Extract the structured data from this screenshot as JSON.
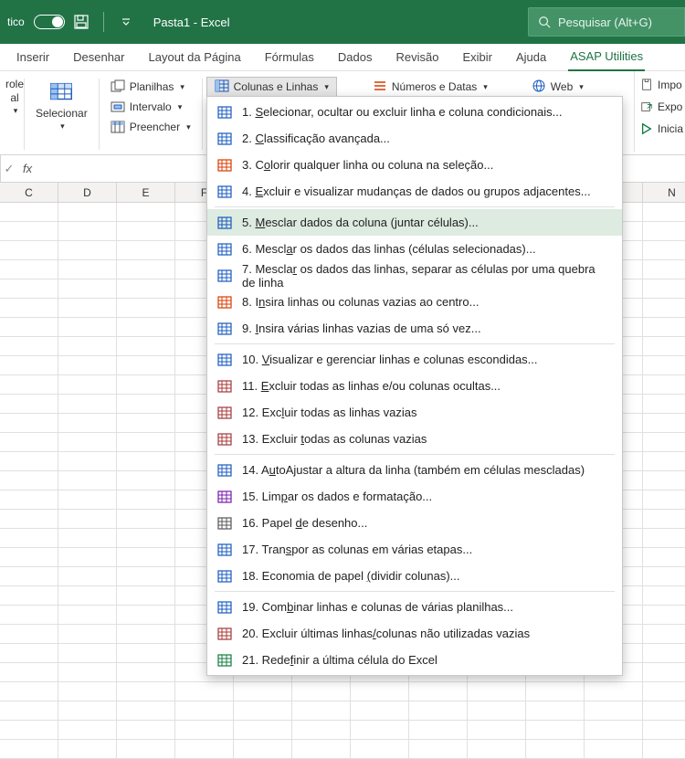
{
  "titlebar": {
    "auto_label": "tico",
    "title": "Pasta1  -  Excel",
    "search_placeholder": "Pesquisar (Alt+G)"
  },
  "tabs": {
    "inserir": "Inserir",
    "desenhar": "Desenhar",
    "layout": "Layout da Página",
    "formulas": "Fórmulas",
    "dados": "Dados",
    "revisao": "Revisão",
    "exibir": "Exibir",
    "ajuda": "Ajuda",
    "asap": "ASAP Utilities"
  },
  "ribbon": {
    "role_top": "role",
    "role_bottom": "al",
    "selecionar": "Selecionar",
    "planilhas": "Planilhas",
    "intervalo": "Intervalo",
    "preencher": "Preencher",
    "colunaslinhas": "Colunas e Linhas",
    "numerosdatas": "Números e Datas",
    "web": "Web",
    "impo": "Impo",
    "expo": "Expo",
    "inicia": "Inicia"
  },
  "formula": {
    "fx": "fx"
  },
  "columns": [
    "C",
    "D",
    "E",
    "F",
    "",
    "",
    "",
    "",
    "",
    "",
    "",
    "N"
  ],
  "menu": {
    "items": [
      {
        "n": "1.",
        "pre": "",
        "u": "S",
        "post": "elecionar, ocultar ou excluir linha e coluna condicionais..."
      },
      {
        "n": "2.",
        "pre": "",
        "u": "C",
        "post": "lassificação avançada..."
      },
      {
        "n": "3.",
        "pre": "C",
        "u": "o",
        "post": "lorir qualquer linha ou coluna na seleção..."
      },
      {
        "n": "4.",
        "pre": "",
        "u": "E",
        "post": "xcluir e visualizar mudanças de dados ou grupos adjacentes..."
      },
      {
        "n": "5.",
        "pre": "",
        "u": "M",
        "post": "esclar dados da coluna (juntar células)...",
        "hover": true
      },
      {
        "n": "6.",
        "pre": "Mescl",
        "u": "a",
        "post": "r os dados das linhas (células selecionadas)..."
      },
      {
        "n": "7.",
        "pre": "Mescla",
        "u": "r",
        "post": " os dados das linhas, separar as células por uma quebra de linha"
      },
      {
        "n": "8.",
        "pre": "I",
        "u": "n",
        "post": "sira linhas ou colunas vazias ao centro..."
      },
      {
        "n": "9.",
        "pre": "",
        "u": "I",
        "post": "nsira várias linhas vazias de uma só vez..."
      },
      {
        "n": "10.",
        "pre": "",
        "u": "V",
        "post": "isualizar e gerenciar linhas e colunas escondidas..."
      },
      {
        "n": "11.",
        "pre": "",
        "u": "E",
        "post": "xcluir todas as linhas e/ou colunas ocultas..."
      },
      {
        "n": "12.",
        "pre": "Exc",
        "u": "l",
        "post": "uir todas as linhas vazias"
      },
      {
        "n": "13.",
        "pre": "Excluir ",
        "u": "t",
        "post": "odas as colunas vazias"
      },
      {
        "n": "14.",
        "pre": "A",
        "u": "u",
        "post": "toAjustar a altura da linha (também em células mescladas)"
      },
      {
        "n": "15.",
        "pre": "Lim",
        "u": "p",
        "post": "ar os dados e formatação..."
      },
      {
        "n": "16.",
        "pre": "Papel ",
        "u": "d",
        "post": "e desenho..."
      },
      {
        "n": "17.",
        "pre": "Tran",
        "u": "s",
        "post": "por as colunas em várias etapas..."
      },
      {
        "n": "18.",
        "pre": "Economia de papel ",
        "u": "(",
        "post": "dividir colunas)..."
      },
      {
        "n": "19.",
        "pre": "Com",
        "u": "b",
        "post": "inar linhas e colunas de várias planilhas..."
      },
      {
        "n": "20.",
        "pre": "Excluir últimas linhas",
        "u": "/",
        "post": "colunas não utilizadas vazias"
      },
      {
        "n": "21.",
        "pre": "Rede",
        "u": "f",
        "post": "inir a última célula do Excel"
      }
    ],
    "separators_after": [
      4,
      9,
      13,
      18
    ]
  }
}
